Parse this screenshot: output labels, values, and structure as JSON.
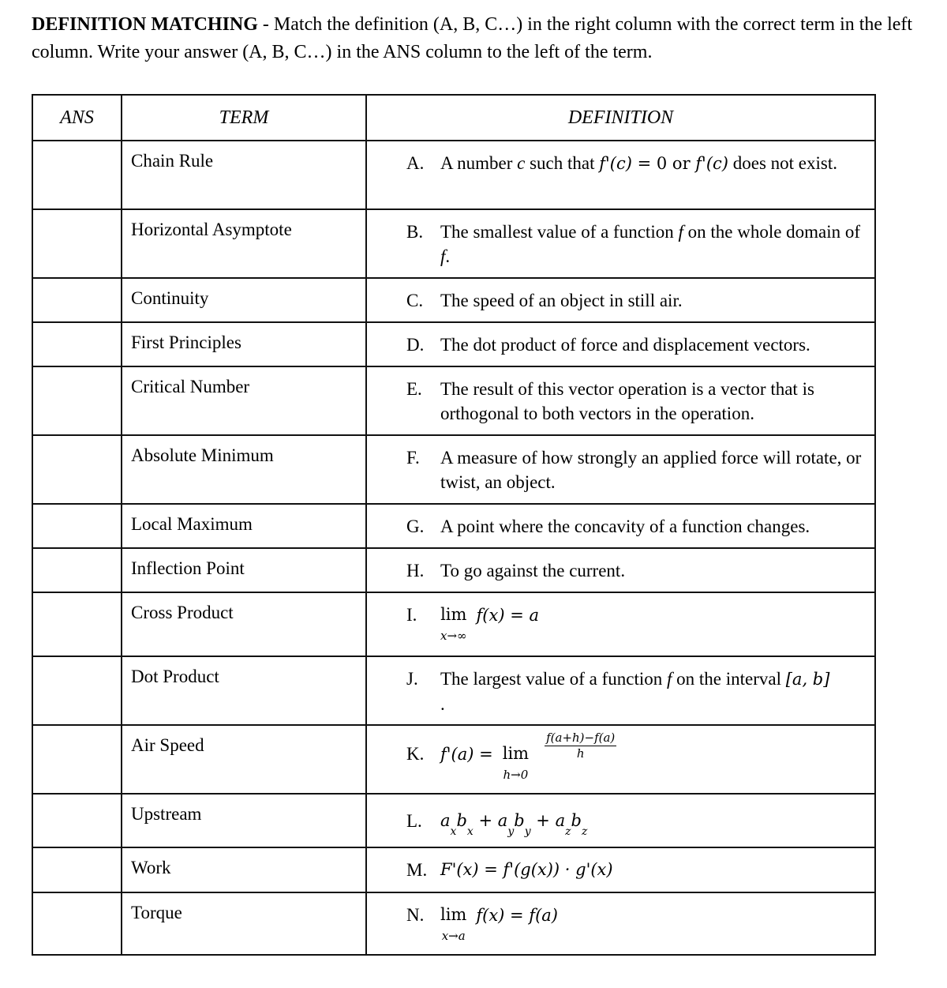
{
  "instructions": {
    "bold_title": "DEFINITION MATCHING",
    "text": " - Match the definition (A, B, C…) in the right column with the correct term in the left column. Write your answer (A, B, C…) in the ANS column to the left of the term."
  },
  "table": {
    "headers": {
      "ans": "ANS",
      "term": "TERM",
      "definition": "DEFINITION"
    },
    "rows": [
      {
        "answer": "",
        "term": "Chain Rule",
        "letter": "A.",
        "definition": "A number c such that f'(c) = 0 or f'(c) does not exist."
      },
      {
        "answer": "",
        "term": "Horizontal Asymptote",
        "letter": "B.",
        "definition": "The smallest value of a function f on the whole domain of f."
      },
      {
        "answer": "",
        "term": "Continuity",
        "letter": "C.",
        "definition": "The speed of an object in still air."
      },
      {
        "answer": "",
        "term": "First Principles",
        "letter": "D.",
        "definition": "The dot product of force and displacement vectors."
      },
      {
        "answer": "",
        "term": "Critical Number",
        "letter": "E.",
        "definition": "The result of this vector operation is a vector that is orthogonal to both vectors in the operation."
      },
      {
        "answer": "",
        "term": "Absolute Minimum",
        "letter": "F.",
        "definition": "A measure of how strongly an applied force will rotate, or twist, an object."
      },
      {
        "answer": "",
        "term": "Local Maximum",
        "letter": "G.",
        "definition": "A point where the concavity of a function changes."
      },
      {
        "answer": "",
        "term": "Inflection Point",
        "letter": "H.",
        "definition": "To go against the current."
      },
      {
        "answer": "",
        "term": "Cross Product",
        "letter": "I.",
        "definition": "lim x→∞ f(x) = a"
      },
      {
        "answer": "",
        "term": "Dot Product",
        "letter": "J.",
        "definition": "The largest value of a function f on the interval [a, b]."
      },
      {
        "answer": "",
        "term": "Air Speed",
        "letter": "K.",
        "definition": "f'(a) = lim h→0 (f(a+h)−f(a))/h"
      },
      {
        "answer": "",
        "term": "Upstream",
        "letter": "L.",
        "definition": "a_x b_x + a_y b_y + a_z b_z"
      },
      {
        "answer": "",
        "term": "Work",
        "letter": "M.",
        "definition": "F'(x) = f'(g(x)) · g'(x)"
      },
      {
        "answer": "",
        "term": "Torque",
        "letter": "N.",
        "definition": "lim x→a f(x) = f(a)"
      }
    ],
    "math": {
      "A": {
        "pre": "A number ",
        "c": "c",
        "mid1": " such that ",
        "f1": "f'(c)",
        "eq": " = 0 or ",
        "f2": "f'(c)",
        "post": " does not exist."
      },
      "B": {
        "pre": "The smallest value of a function ",
        "f": "f",
        "mid": " on the whole domain of ",
        "f2": "f",
        "post": "."
      },
      "I": {
        "lim": "lim",
        "sub": "x→∞",
        "expr": "f(x) = a"
      },
      "J": {
        "pre": "The largest value of a function ",
        "f": "f",
        "mid": " on the interval ",
        "interval": "[a, b]",
        "post": "."
      },
      "K": {
        "lhs": "f'(a) =",
        "lim": "lim",
        "sub": "h→0",
        "num": "f(a+h)−f(a)",
        "den": "h"
      },
      "L": {
        "a": "a",
        "b": "b",
        "x": "x",
        "y": "y",
        "z": "z",
        "plus": "+"
      },
      "M": {
        "expr": "F'(x) = f'(g(x)) · g'(x)"
      },
      "N": {
        "lim": "lim",
        "sub": "x→a",
        "expr": "f(x) = f(a)"
      }
    }
  }
}
